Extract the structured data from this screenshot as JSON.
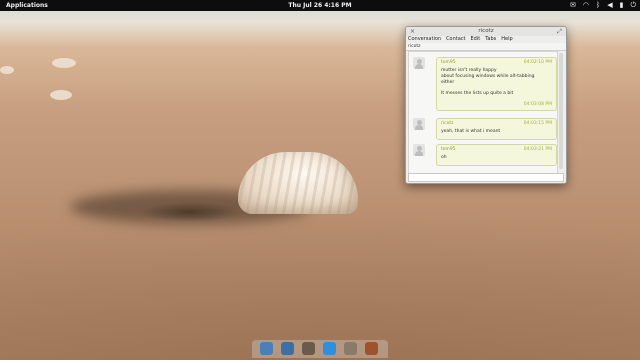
{
  "top_panel": {
    "applications_label": "Applications",
    "clock": "Thu Jul 26  4:16 PM",
    "indicators": [
      {
        "icon": "mail-icon",
        "glyph": "✉"
      },
      {
        "icon": "wifi-icon",
        "glyph": "◠"
      },
      {
        "icon": "bluetooth-icon",
        "glyph": "ᛒ"
      },
      {
        "icon": "volume-icon",
        "glyph": "◀"
      },
      {
        "icon": "battery-icon",
        "glyph": "▮"
      },
      {
        "icon": "power-icon",
        "glyph": "⏻"
      }
    ]
  },
  "chat_window": {
    "title": "ricotz",
    "close_glyph": "×",
    "maximize_glyph": "⤢",
    "menu": [
      "Conversation",
      "Contact",
      "Edit",
      "Tabs",
      "Help"
    ],
    "tab_label": "ricotz",
    "messages": [
      {
        "sender": "tom95",
        "time": "04:02:10 PM",
        "lines": [
          "mutter isn't really happy",
          "about focusing windows while alt-tabbing",
          "either"
        ],
        "second_line": "It messes the lists up quite a bit",
        "second_time": "04:03:08 PM"
      },
      {
        "sender": "ricotz",
        "time": "04:03:15 PM",
        "lines": [
          "yeah, that is what i meant"
        ]
      },
      {
        "sender": "tom95",
        "time": "04:03:21 PM",
        "lines": [
          "oh"
        ]
      }
    ]
  },
  "dock": {
    "items": [
      {
        "icon": "files-app-icon",
        "color": "#4a7fb8"
      },
      {
        "icon": "web-browser-app-icon",
        "color": "#3b6fa6"
      },
      {
        "icon": "terminal-app-icon",
        "color": "#6b5a4a"
      },
      {
        "icon": "chat-app-icon",
        "color": "#2f8fdf"
      },
      {
        "icon": "photos-app-icon",
        "color": "#8a7a6a"
      },
      {
        "icon": "system-settings-app-icon",
        "color": "#a0522d"
      }
    ]
  },
  "colors": {
    "panel": "#0d0d0d",
    "bubble": "#f4f7dc",
    "sender": "#8e9d3b"
  }
}
